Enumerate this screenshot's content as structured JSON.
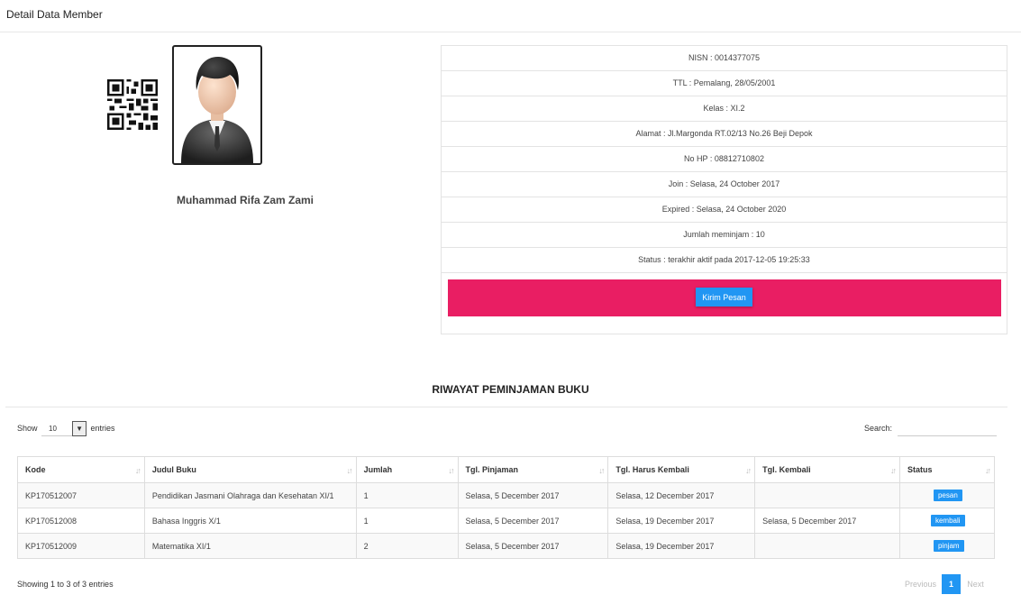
{
  "header": {
    "title": "Detail Data Member"
  },
  "member": {
    "name": "Muhammad Rifa Zam Zami",
    "info_rows": [
      "NISN : 0014377075",
      "TTL : Pemalang, 28/05/2001",
      "Kelas : XI.2",
      "Alamat : Jl.Margonda RT.02/13 No.26 Beji Depok",
      "No HP : 08812710802",
      "Join : Selasa, 24 October 2017",
      "Expired : Selasa, 24 October 2020",
      "Jumlah meminjam : 10",
      "Status : terakhir aktif pada 2017-12-05 19:25:33"
    ],
    "send_button": "Kirim Pesan"
  },
  "history": {
    "title": "RIWAYAT PEMINJAMAN BUKU",
    "length": {
      "show": "Show",
      "value": "10",
      "entries": "entries"
    },
    "search_label": "Search:",
    "columns": [
      "Kode",
      "Judul Buku",
      "Jumlah",
      "Tgl. Pinjaman",
      "Tgl. Harus Kembali",
      "Tgl. Kembali",
      "Status"
    ],
    "rows": [
      [
        "KP170512007",
        "Pendidikan Jasmani Olahraga dan Kesehatan XI/1",
        "1",
        "Selasa, 5 December 2017",
        "Selasa, 12 December 2017",
        "",
        "pesan"
      ],
      [
        "KP170512008",
        "Bahasa Inggris X/1",
        "1",
        "Selasa, 5 December 2017",
        "Selasa, 19 December 2017",
        "Selasa, 5 December 2017",
        "kembali"
      ],
      [
        "KP170512009",
        "Matematika XI/1",
        "2",
        "Selasa, 5 December 2017",
        "Selasa, 19 December 2017",
        "",
        "pinjam"
      ]
    ],
    "info": "Showing 1 to 3 of 3 entries",
    "pagination": {
      "previous": "Previous",
      "current": "1",
      "next": "Next"
    }
  },
  "colors": {
    "accent_pink": "#e91e63",
    "accent_blue": "#2196f3"
  }
}
